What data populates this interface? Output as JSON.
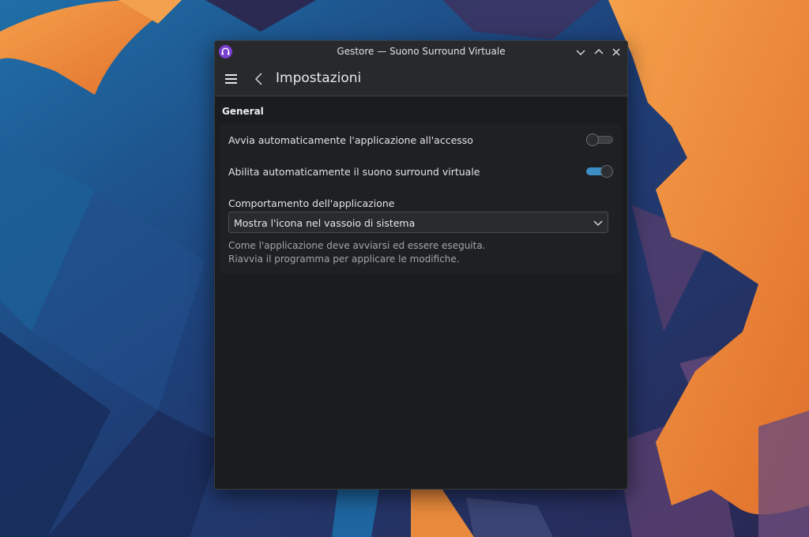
{
  "window": {
    "title": "Gestore — Suono Surround Virtuale",
    "app_icon": "headphones-icon"
  },
  "toolbar": {
    "menu_icon": "hamburger-menu-icon",
    "back_icon": "chevron-left-icon",
    "page_title": "Impostazioni"
  },
  "settings": {
    "section_title": "General",
    "autostart": {
      "label": "Avvia automaticamente l'applicazione all'accesso",
      "enabled": false
    },
    "virtual_surround": {
      "label": "Abilita automaticamente il suono surround virtuale",
      "enabled": true
    },
    "behavior": {
      "label": "Comportamento dell'applicazione",
      "selected": "Mostra l'icona nel vassoio di sistema",
      "help_line1": "Come l'applicazione deve avviarsi ed essere eseguita.",
      "help_line2": "Riavvia il programma per applicare le modifiche."
    }
  },
  "colors": {
    "accent": "#3d8ec4",
    "window_bg": "#1b1c1e",
    "header_bg": "#28292c",
    "wallpaper_orange": "#f0913a",
    "wallpaper_blue": "#1f6fa8"
  }
}
